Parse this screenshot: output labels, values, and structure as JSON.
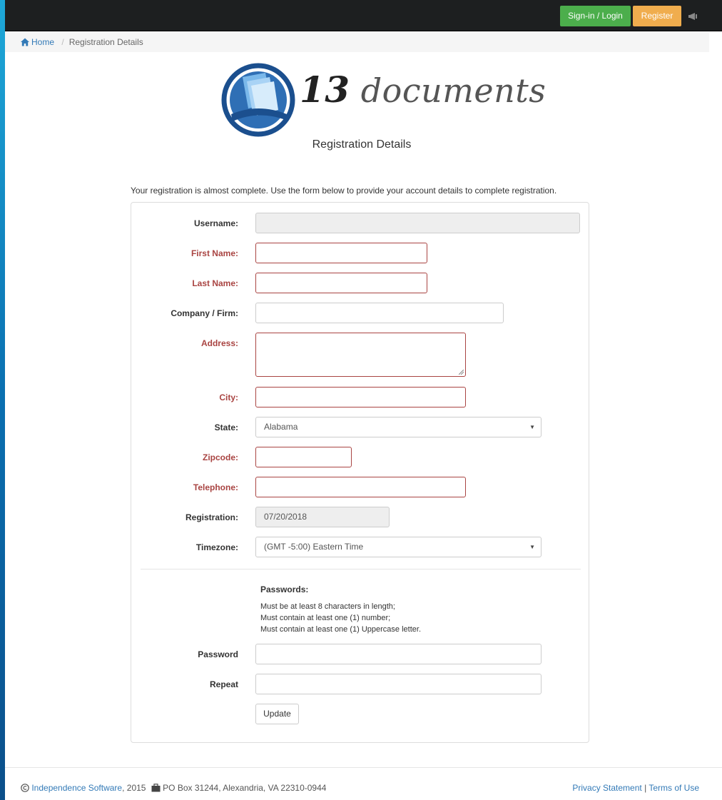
{
  "nav": {
    "signin_label": "Sign-in / Login",
    "register_label": "Register"
  },
  "breadcrumb": {
    "home": "Home",
    "current": "Registration Details"
  },
  "logo": {
    "number": "13",
    "word": "documents"
  },
  "page_title": "Registration Details",
  "intro": "Your registration is almost complete. Use the form below to provide your account details to complete registration.",
  "form": {
    "username_label": "Username:",
    "username_value": "",
    "first_name_label": "First Name:",
    "last_name_label": "Last Name:",
    "company_label": "Company / Firm:",
    "address_label": "Address:",
    "city_label": "City:",
    "state_label": "State:",
    "state_value": "Alabama",
    "zipcode_label": "Zipcode:",
    "telephone_label": "Telephone:",
    "registration_label": "Registration:",
    "registration_value": "07/20/2018",
    "timezone_label": "Timezone:",
    "timezone_value": "(GMT -5:00) Eastern Time",
    "passwords_heading": "Passwords:",
    "password_rules": [
      "Must be at least 8 characters in length;",
      "Must contain at least one (1) number;",
      "Must contain at least one (1) Uppercase letter."
    ],
    "password_label": "Password",
    "repeat_label": "Repeat",
    "update_label": "Update"
  },
  "footer": {
    "company": "Independence Software",
    "year": ", 2015",
    "address": "PO Box 31244, Alexandria, VA 22310-0944",
    "privacy": "Privacy Statement",
    "separator": " | ",
    "terms": "Terms of Use"
  },
  "colors": {
    "signin": "#4cae4c",
    "register": "#f0ad4e",
    "required": "#a94442",
    "link": "#337ab7"
  }
}
